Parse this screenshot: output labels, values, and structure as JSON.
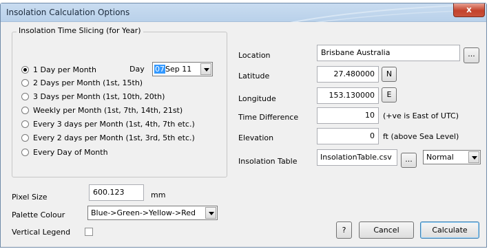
{
  "window": {
    "title": "Insolation Calculation Options",
    "close_glyph": "x"
  },
  "slicing": {
    "group_title": "Insolation Time Slicing (for Year)",
    "options": [
      {
        "label": "1 Day per Month",
        "checked": true
      },
      {
        "label": "2 Days per Month (1st, 15th)",
        "checked": false
      },
      {
        "label": "3 Days per Month (1st, 10th, 20th)",
        "checked": false
      },
      {
        "label": "Weekly per Month (1st, 7th, 14th, 21st)",
        "checked": false
      },
      {
        "label": "Every 3 days per Month (1st, 4th, 7th etc.)",
        "checked": false
      },
      {
        "label": "Every 2 days per Month (1st, 3rd, 5th etc.)",
        "checked": false
      },
      {
        "label": "Every Day of Month",
        "checked": false
      }
    ],
    "day_label": "Day",
    "day_selected": "07",
    "day_rest": " Sep 11"
  },
  "location": {
    "location_label": "Location",
    "location_value": "Brisbane  Australia",
    "browse_label": "...",
    "latitude_label": "Latitude",
    "latitude_value": "27.480000",
    "latitude_dir": "N",
    "longitude_label": "Longitude",
    "longitude_value": "153.130000",
    "longitude_dir": "E",
    "timediff_label": "Time Difference",
    "timediff_value": "10",
    "timediff_note": "(+ve is East of UTC)",
    "elevation_label": "Elevation",
    "elevation_value": "0",
    "elevation_note": "ft  (above Sea Level)",
    "table_label": "Insolation Table",
    "table_value": "InsolationTable.csv",
    "table_browse_label": "...",
    "table_mode": "Normal"
  },
  "bottom": {
    "pixel_size_label": "Pixel Size",
    "pixel_size_value": "600.123",
    "pixel_size_unit": "mm",
    "palette_label": "Palette Colour",
    "palette_value": "Blue->Green->Yellow->Red",
    "vertical_legend_label": "Vertical Legend",
    "vertical_legend_checked": false,
    "help_label": "?",
    "cancel_label": "Cancel",
    "calculate_label": "Calculate"
  },
  "colors": {
    "title_bar": "#c9dcf0",
    "close_button": "#c3422c",
    "highlight": "#3399ff"
  }
}
